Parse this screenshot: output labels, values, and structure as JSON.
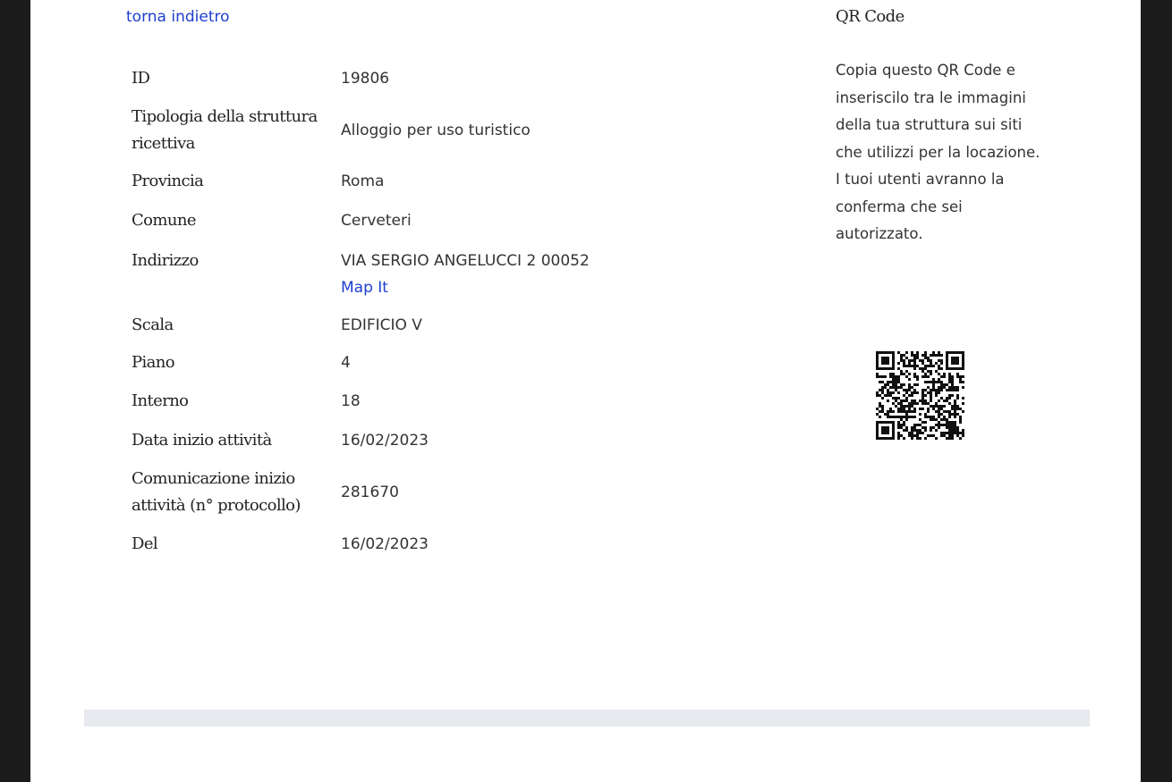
{
  "nav": {
    "back_label": "torna indietro"
  },
  "details": {
    "rows": [
      {
        "label": "ID",
        "value": "19806"
      },
      {
        "label": "Tipologia della struttura ricettiva",
        "value": "Alloggio per uso turistico"
      },
      {
        "label": "Provincia",
        "value": "Roma"
      },
      {
        "label": "Comune",
        "value": "Cerveteri"
      },
      {
        "label": "Indirizzo",
        "value": "VIA SERGIO ANGELUCCI 2 00052",
        "link": "Map It"
      },
      {
        "label": "Scala",
        "value": "EDIFICIO V"
      },
      {
        "label": "Piano",
        "value": "4"
      },
      {
        "label": "Interno",
        "value": "18"
      },
      {
        "label": "Data inizio attività",
        "value": "16/02/2023"
      },
      {
        "label": "Comunicazione inizio attività (n° protocollo)",
        "value": "281670"
      },
      {
        "label": "Del",
        "value": "16/02/2023"
      }
    ]
  },
  "qr": {
    "title": "QR Code",
    "description": "Copia questo QR Code e inseriscilo tra le immagini della tua struttura sui siti che utilizzi per la locazione. I tuoi utenti avranno la conferma che sei autorizzato."
  },
  "colors": {
    "link": "#1d3fcc",
    "footer_bar": "#e8e9ee",
    "page_background": "#ffffff",
    "outer_background": "#1c1c1c"
  }
}
